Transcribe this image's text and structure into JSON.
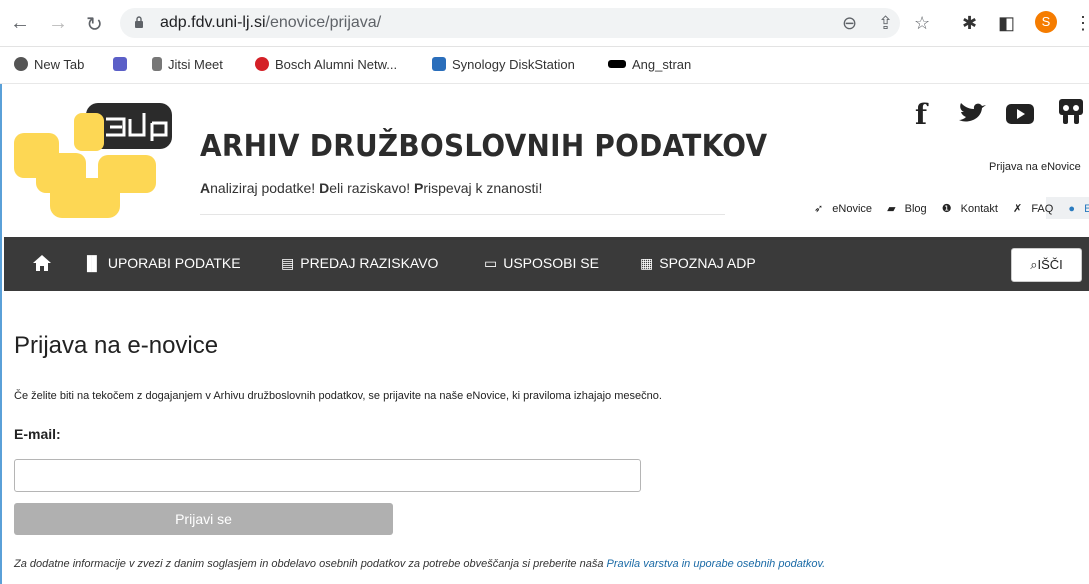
{
  "browser": {
    "url_host": "adp.fdv.uni-lj.si",
    "url_path": "/enovice/prijava/",
    "profile_initial": "S",
    "bookmarks": [
      {
        "label": "New Tab"
      },
      {
        "label": ""
      },
      {
        "label": "Jitsi Meet"
      },
      {
        "label": "Bosch Alumni Netw..."
      },
      {
        "label": "Synology DiskStation"
      },
      {
        "label": "Ang_stran"
      }
    ]
  },
  "header": {
    "site_title": "ARHIV DRUŽBOSLOVNIH PODATKOV",
    "tagline": {
      "a1": "A",
      "t1": "naliziraj podatke! ",
      "a2": "D",
      "t2": "eli raziskavo! ",
      "a3": "P",
      "t3": "rispevaj k znanosti!"
    },
    "newsletter_link": "Prijava na eNovice",
    "top_links": [
      "eNovice",
      "Blog",
      "Kontakt",
      "FAQ",
      "EN"
    ]
  },
  "nav": {
    "items": [
      "UPORABI PODATKE",
      "PREDAJ RAZISKAVO",
      "USPOSOBI SE",
      "SPOZNAJ ADP"
    ],
    "search_label": "IŠČI"
  },
  "content": {
    "title": "Prijava na e-novice",
    "intro": "Če želite biti na tekočem z dogajanjem v Arhivu družboslovnih podatkov, se prijavite na naše eNovice, ki praviloma izhajajo mesečno.",
    "email_label": "E-mail:",
    "email_value": "",
    "submit_label": "Prijavi se",
    "footnote_text": "Za dodatne informacije v zvezi z danim soglasjem in obdelavo osebnih podatkov za potrebe obveščanja si preberite naša ",
    "footnote_link": "Pravila varstva in uporabe osebnih podatkov."
  },
  "colors": {
    "logo_yellow": "#fdd754",
    "logo_dark": "#2b2b2b",
    "navbar": "#3a3a3a",
    "link": "#1a6aa6",
    "button_disabled": "#b0b0b0"
  }
}
